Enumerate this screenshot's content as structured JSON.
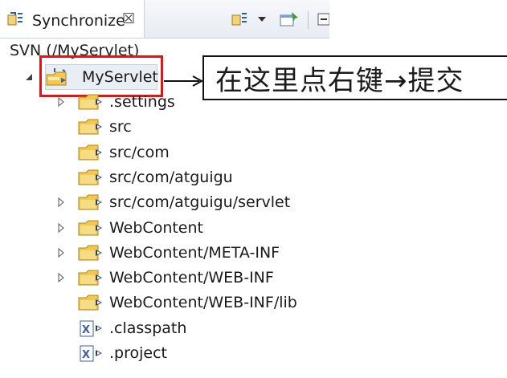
{
  "view": {
    "tab_title": "Synchronize",
    "close_glyph": "☒",
    "path_label": "SVN (/MyServlet)"
  },
  "toolbar": {
    "icons": [
      "sync-mode-icon",
      "dropdown-icon",
      "pin-icon",
      "collapse-icon"
    ]
  },
  "tree": {
    "root": {
      "label": "MyServlet",
      "expanded": true
    },
    "items": [
      {
        "label": ".settings",
        "expandable": true,
        "type": "folder"
      },
      {
        "label": "src",
        "expandable": false,
        "type": "folder"
      },
      {
        "label": "src/com",
        "expandable": false,
        "type": "folder"
      },
      {
        "label": "src/com/atguigu",
        "expandable": false,
        "type": "folder"
      },
      {
        "label": "src/com/atguigu/servlet",
        "expandable": true,
        "type": "folder"
      },
      {
        "label": "WebContent",
        "expandable": true,
        "type": "folder"
      },
      {
        "label": "WebContent/META-INF",
        "expandable": true,
        "type": "folder"
      },
      {
        "label": "WebContent/WEB-INF",
        "expandable": true,
        "type": "folder"
      },
      {
        "label": "WebContent/WEB-INF/lib",
        "expandable": false,
        "type": "folder"
      },
      {
        "label": ".classpath",
        "expandable": false,
        "type": "file"
      },
      {
        "label": ".project",
        "expandable": false,
        "type": "file"
      }
    ]
  },
  "annotation": {
    "text": "在这里点右键→提交",
    "highlight_color": "#e01616"
  }
}
